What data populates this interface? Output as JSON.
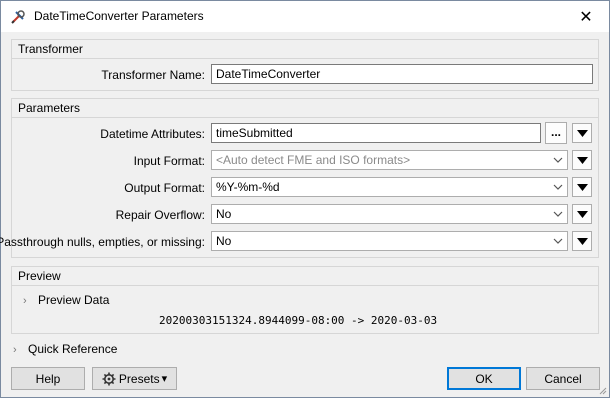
{
  "window": {
    "title": "DateTimeConverter Parameters",
    "close_glyph": "✕"
  },
  "transformer_group": {
    "label": "Transformer",
    "name_label": "Transformer Name:",
    "name_value": "DateTimeConverter"
  },
  "parameters_group": {
    "label": "Parameters",
    "datetime_attributes": {
      "label": "Datetime Attributes:",
      "value": "timeSubmitted",
      "browse_label": "..."
    },
    "input_format": {
      "label": "Input Format:",
      "placeholder": "<Auto detect FME and ISO formats>"
    },
    "output_format": {
      "label": "Output Format:",
      "value": "%Y-%m-%d"
    },
    "repair_overflow": {
      "label": "Repair Overflow:",
      "value": "No"
    },
    "passthrough": {
      "label": "Passthrough nulls, empties, or missing:",
      "value": "No"
    }
  },
  "preview_group": {
    "label": "Preview",
    "toggle_label": "Preview Data",
    "result_text": "20200303151324.8944099-08:00 -> 2020-03-03"
  },
  "quick_reference": {
    "label": "Quick Reference"
  },
  "footer": {
    "help_label": "Help",
    "presets_label": "Presets",
    "presets_arrow": "▾",
    "ok_label": "OK",
    "cancel_label": "Cancel"
  },
  "icons": {
    "title_icon": "transformer-icon",
    "chevron": "chevron-down-icon",
    "menu_arrow": "triangle-down-icon",
    "caret": "chevron-right-icon",
    "gear": "gear-icon"
  },
  "colors": {
    "accent": "#0078d7",
    "disabled_text": "#8a8a8a"
  }
}
